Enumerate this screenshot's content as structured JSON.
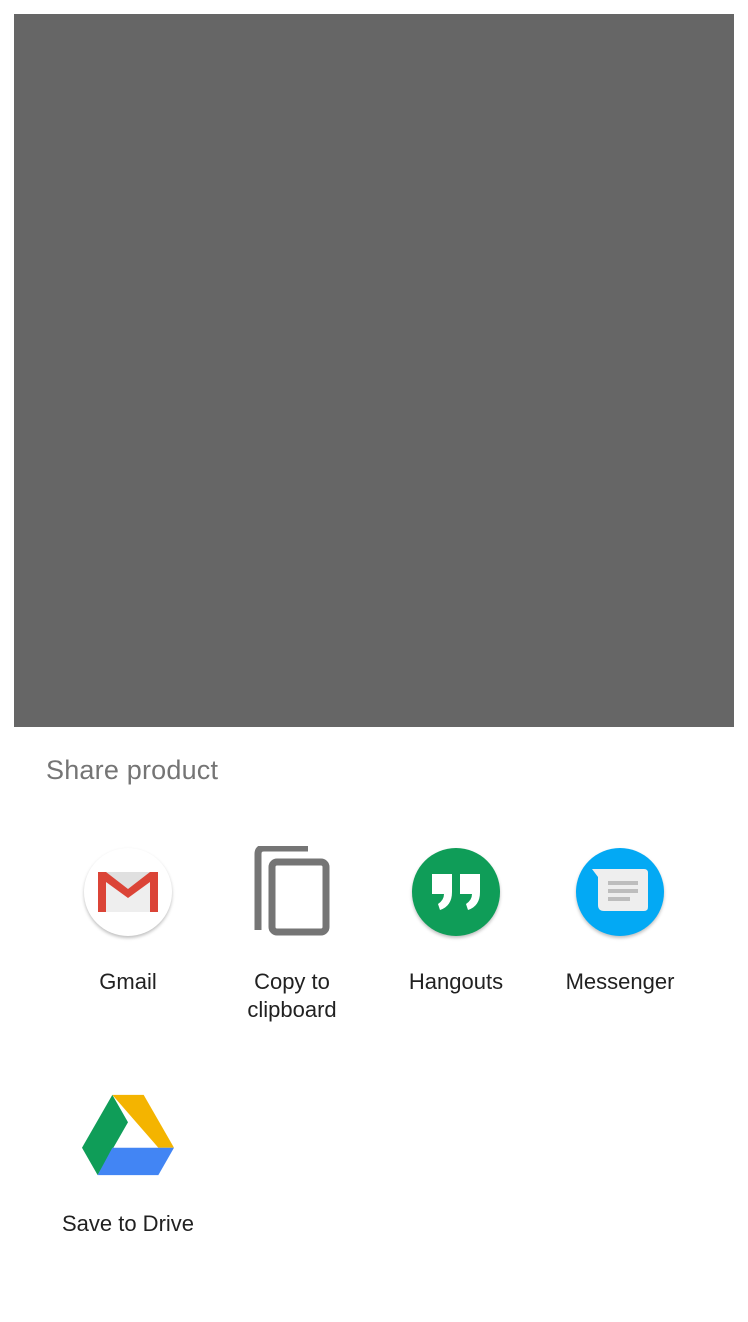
{
  "share_sheet": {
    "title": "Share product",
    "apps": [
      {
        "label": "Gmail",
        "icon": "gmail-icon"
      },
      {
        "label": "Copy to clipboard",
        "icon": "copy-icon"
      },
      {
        "label": "Hangouts",
        "icon": "hangouts-icon"
      },
      {
        "label": "Messenger",
        "icon": "messenger-icon"
      },
      {
        "label": "Save to Drive",
        "icon": "drive-icon"
      }
    ]
  },
  "colors": {
    "scrim": "#666666",
    "title": "#757575",
    "label": "#212121",
    "gmail_red": "#DB4437",
    "hangouts_green": "#0F9D58",
    "messenger_blue": "#03A9F4",
    "drive_green": "#0F9D58",
    "drive_yellow": "#F4B400",
    "drive_blue": "#4285F4"
  }
}
